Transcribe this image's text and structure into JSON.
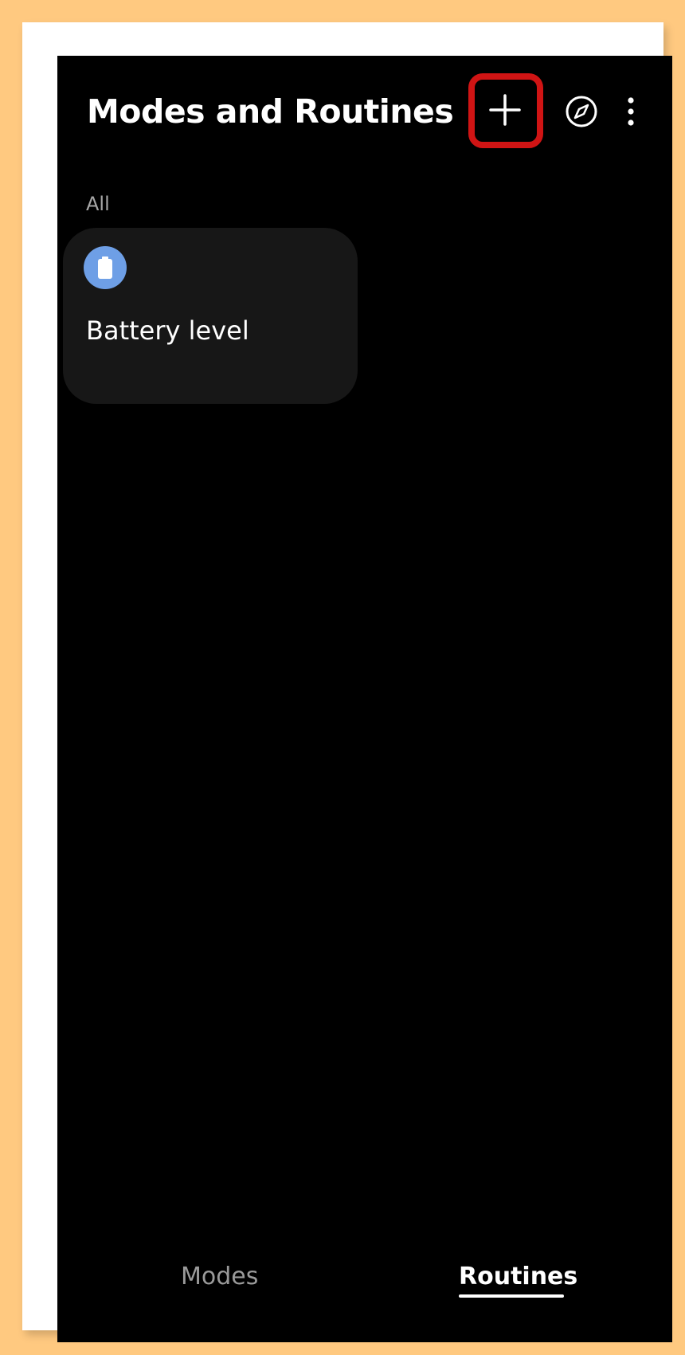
{
  "header": {
    "title": "Modes and Routines",
    "icons": {
      "add": "plus-icon",
      "discover": "compass-icon",
      "more": "more-vertical-icon"
    },
    "highlight_color": "#d01414"
  },
  "section": {
    "label": "All"
  },
  "routines": [
    {
      "title": "Battery level",
      "icon": "battery-icon",
      "icon_color": "#6e9fe6"
    }
  ],
  "bottom_tabs": [
    {
      "label": "Modes",
      "selected": false
    },
    {
      "label": "Routines",
      "selected": true
    }
  ],
  "colors": {
    "background": "#000000",
    "card": "#171717",
    "frame_border": "#ffc980"
  }
}
